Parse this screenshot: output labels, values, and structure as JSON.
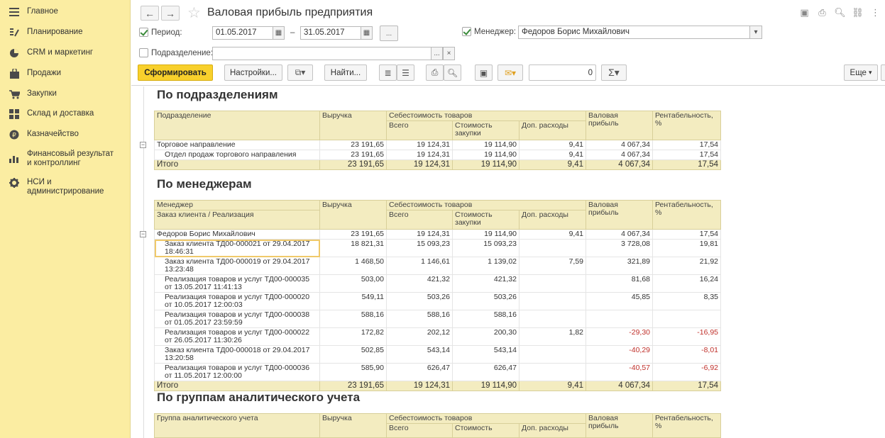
{
  "sidebar": {
    "items": [
      {
        "icon": "menu-icon",
        "label": "Главное"
      },
      {
        "icon": "planning-icon",
        "label": "Планирование"
      },
      {
        "icon": "pie-chart-icon",
        "label": "CRM и маркетинг"
      },
      {
        "icon": "bag-icon",
        "label": "Продажи"
      },
      {
        "icon": "cart-icon",
        "label": "Закупки"
      },
      {
        "icon": "grid-icon",
        "label": "Склад и доставка"
      },
      {
        "icon": "coin-icon",
        "label": "Казначейство"
      },
      {
        "icon": "bar-chart-icon",
        "label": "Финансовый результат и контроллинг"
      },
      {
        "icon": "gear-icon",
        "label": "НСИ и администрирование"
      }
    ]
  },
  "header": {
    "title": "Валовая прибыль предприятия"
  },
  "filters": {
    "period_label": "Период:",
    "date_from": "01.05.2017",
    "date_sep": "–",
    "date_to": "31.05.2017",
    "period_more": "...",
    "manager_label": "Менеджер:",
    "manager_value": "Федоров Борис Михайлович",
    "division_label": "Подразделение:",
    "division_value": "",
    "division_more": "...",
    "division_clear": "×"
  },
  "toolbar": {
    "generate": "Сформировать",
    "settings": "Настройки...",
    "find": "Найти...",
    "sum_value": "0",
    "more": "Еще"
  },
  "sections": {
    "by_division": {
      "title": "По подразделениям",
      "header": {
        "col1": "Подразделение",
        "revenue": "Выручка",
        "cost": "Себестоимость товаров",
        "total": "Всего",
        "purchase": "Стоимость закупки",
        "extra": "Доп. расходы",
        "gross": "Валовая прибыль",
        "profit": "Рентабельность, %"
      },
      "rows": [
        {
          "name": "Торговое направление",
          "revenue": "23 191,65",
          "total": "19 124,31",
          "purchase": "19 114,90",
          "extra": "9,41",
          "gross": "4 067,34",
          "profit": "17,54"
        },
        {
          "name": "Отдел продаж торгового направления",
          "revenue": "23 191,65",
          "total": "19 124,31",
          "purchase": "19 114,90",
          "extra": "9,41",
          "gross": "4 067,34",
          "profit": "17,54"
        }
      ],
      "totals": {
        "name": "Итого",
        "revenue": "23 191,65",
        "total": "19 124,31",
        "purchase": "19 114,90",
        "extra": "9,41",
        "gross": "4 067,34",
        "profit": "17,54"
      }
    },
    "by_manager": {
      "title": "По менеджерам",
      "header": {
        "col1": "Менеджер",
        "col1b": "Заказ клиента / Реализация",
        "revenue": "Выручка",
        "cost": "Себестоимость товаров",
        "total": "Всего",
        "purchase": "Стоимость закупки",
        "extra": "Доп. расходы",
        "gross": "Валовая прибыль",
        "profit": "Рентабельность, %"
      },
      "group": {
        "name": "Федоров Борис Михайлович",
        "revenue": "23 191,65",
        "total": "19 124,31",
        "purchase": "19 114,90",
        "extra": "9,41",
        "gross": "4 067,34",
        "profit": "17,54"
      },
      "rows": [
        {
          "name": "Заказ клиента ТД00-000021 от 29.04.2017 18:46:31",
          "revenue": "18 821,31",
          "total": "15 093,23",
          "purchase": "15 093,23",
          "extra": "",
          "gross": "3 728,08",
          "profit": "19,81",
          "neg": false
        },
        {
          "name": "Заказ клиента ТД00-000019 от 29.04.2017 13:23:48",
          "revenue": "1 468,50",
          "total": "1 146,61",
          "purchase": "1 139,02",
          "extra": "7,59",
          "gross": "321,89",
          "profit": "21,92",
          "neg": false
        },
        {
          "name": "Реализация товаров и услуг ТД00-000035 от 13.05.2017 11:41:13",
          "revenue": "503,00",
          "total": "421,32",
          "purchase": "421,32",
          "extra": "",
          "gross": "81,68",
          "profit": "16,24",
          "neg": false
        },
        {
          "name": "Реализация товаров и услуг ТД00-000020 от 10.05.2017 12:00:03",
          "revenue": "549,11",
          "total": "503,26",
          "purchase": "503,26",
          "extra": "",
          "gross": "45,85",
          "profit": "8,35",
          "neg": false
        },
        {
          "name": "Реализация товаров и услуг ТД00-000038 от 01.05.2017 23:59:59",
          "revenue": "588,16",
          "total": "588,16",
          "purchase": "588,16",
          "extra": "",
          "gross": "",
          "profit": "",
          "neg": false
        },
        {
          "name": "Реализация товаров и услуг ТД00-000022 от 26.05.2017 11:30:26",
          "revenue": "172,82",
          "total": "202,12",
          "purchase": "200,30",
          "extra": "1,82",
          "gross": "-29,30",
          "profit": "-16,95",
          "neg": true
        },
        {
          "name": "Заказ клиента ТД00-000018 от 29.04.2017 13:20:58",
          "revenue": "502,85",
          "total": "543,14",
          "purchase": "543,14",
          "extra": "",
          "gross": "-40,29",
          "profit": "-8,01",
          "neg": true
        },
        {
          "name": "Реализация товаров и услуг ТД00-000036 от 11.05.2017 12:00:00",
          "revenue": "585,90",
          "total": "626,47",
          "purchase": "626,47",
          "extra": "",
          "gross": "-40,57",
          "profit": "-6,92",
          "neg": true
        }
      ],
      "totals": {
        "name": "Итого",
        "revenue": "23 191,65",
        "total": "19 124,31",
        "purchase": "19 114,90",
        "extra": "9,41",
        "gross": "4 067,34",
        "profit": "17,54"
      }
    },
    "by_group": {
      "title": "По группам аналитического учета",
      "header": {
        "col1": "Группа аналитического учета",
        "revenue": "Выручка",
        "cost": "Себестоимость товаров",
        "total": "Всего",
        "purchase": "Стоимость",
        "extra": "Доп. расходы",
        "gross": "Валовая прибыль",
        "profit": "Рентабельность, %"
      }
    }
  },
  "colors": {
    "sidebar_bg": "#fbeda2",
    "primary_button": "#f8d02c",
    "table_header": "#f3ecc0",
    "negative": "#c0312b"
  }
}
